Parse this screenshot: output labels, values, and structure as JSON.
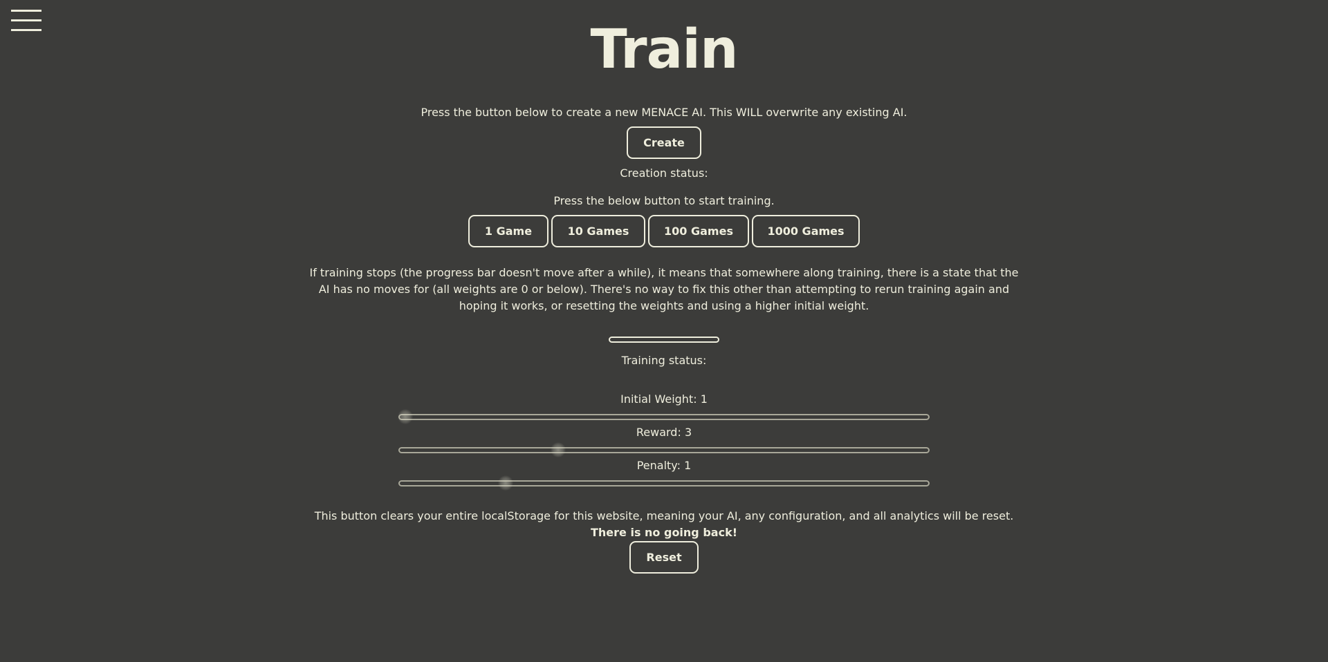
{
  "page": {
    "title": "Train",
    "background": "#3c3c3a",
    "foreground": "#efeedd"
  },
  "menu": {
    "icon": "hamburger-menu-icon"
  },
  "create": {
    "description": "Press the button below to create a new MENACE AI. This WILL overwrite any existing AI.",
    "button_label": "Create",
    "status_label": "Creation status:"
  },
  "training": {
    "description": "Press the below button to start training.",
    "buttons": [
      "1 Game",
      "10 Games",
      "100 Games",
      "1000 Games"
    ],
    "note": "If training stops (the progress bar doesn't move after a while), it means that somewhere along training, there is a state that the AI has no moves for (all weights are 0 or below). There's no way to fix this other than attempting to rerun training again and hoping it works, or resetting the weights and using a higher initial weight.",
    "progress": 0,
    "status_label": "Training status:"
  },
  "settings": {
    "initial_weight": {
      "label": "Initial Weight: 1",
      "value": 1,
      "position_fraction": 0.01
    },
    "reward": {
      "label": "Reward: 3",
      "value": 3,
      "position_fraction": 0.3
    },
    "penalty": {
      "label": "Penalty: 1",
      "value": 1,
      "position_fraction": 0.2
    }
  },
  "reset": {
    "note_text": "This button clears your entire localStorage for this website, meaning your AI, any configuration, and all analytics will be reset.",
    "note_emphasis": "There is no going back!",
    "button_label": "Reset"
  }
}
